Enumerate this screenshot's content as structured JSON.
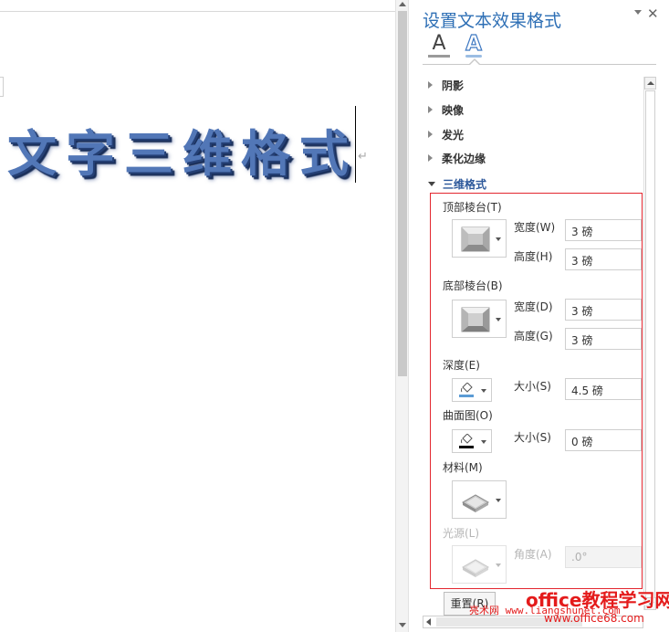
{
  "document": {
    "wordart_text": "文字三维格式",
    "paragraph_mark": "↵"
  },
  "pane": {
    "title": "设置文本效果格式",
    "tabs": [
      {
        "icon": "text-fill-icon",
        "glyph": "A"
      },
      {
        "icon": "text-effects-icon",
        "glyph": "A",
        "selected": true
      }
    ],
    "sections": [
      {
        "label": "阴影",
        "expanded": false
      },
      {
        "label": "映像",
        "expanded": false
      },
      {
        "label": "发光",
        "expanded": false
      },
      {
        "label": "柔化边缘",
        "expanded": false
      },
      {
        "label": "三维格式",
        "expanded": true
      }
    ],
    "three_d": {
      "top_bevel_label": "顶部棱台(T)",
      "top_width_label": "宽度(W)",
      "top_width_value": "3 磅",
      "top_height_label": "高度(H)",
      "top_height_value": "3 磅",
      "bottom_bevel_label": "底部棱台(B)",
      "bottom_width_label": "宽度(D)",
      "bottom_width_value": "3 磅",
      "bottom_height_label": "高度(G)",
      "bottom_height_value": "3 磅",
      "depth_label": "深度(E)",
      "depth_size_label": "大小(S)",
      "depth_size_value": "4.5 磅",
      "depth_color": "#5b9bd5",
      "contour_label": "曲面图(O)",
      "contour_size_label": "大小(S)",
      "contour_size_value": "0 磅",
      "contour_color": "#000000",
      "material_label": "材料(M)",
      "lighting_label": "光源(L)",
      "angle_label": "角度(A)",
      "angle_value": ".0°",
      "reset_label": "重置(R)"
    }
  },
  "watermark": {
    "line1": "office教程学习网",
    "line2": "亮术网 www.liangshunet.com",
    "line3": "www.office68.com"
  },
  "colors": {
    "accent": "#2e6fb5",
    "highlight_box": "#e3262f",
    "wordart": "#5277b7"
  }
}
